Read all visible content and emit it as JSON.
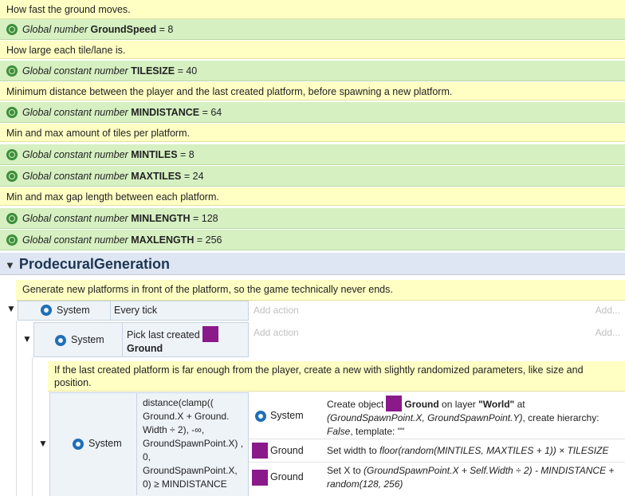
{
  "comments": {
    "c1": "How fast the ground moves.",
    "c2": "How large each tile/lane is.",
    "c3": "Minimum distance between the player and the last created platform, before spawning a new platform.",
    "c4": "Min and max amount of tiles per platform.",
    "c5": "Min and max gap length between each platform.",
    "c6": "Generate new platforms in front of the platform, so the game technically never ends.",
    "c7": "If the last created platform is far enough from the player, create a new with slightly randomized parameters, like size and position."
  },
  "vars": {
    "v1": {
      "prefix": "Global number",
      "name": "GroundSpeed",
      "value": "= 8"
    },
    "v2": {
      "prefix": "Global constant number",
      "name": "TILESIZE",
      "value": "= 40"
    },
    "v3": {
      "prefix": "Global constant number",
      "name": "MINDISTANCE",
      "value": "= 64"
    },
    "v4": {
      "prefix": "Global constant number",
      "name": "MINTILES",
      "value": "= 8"
    },
    "v5": {
      "prefix": "Global constant number",
      "name": "MAXTILES",
      "value": "= 24"
    },
    "v6": {
      "prefix": "Global constant number",
      "name": "MINLENGTH",
      "value": "= 128"
    },
    "v7": {
      "prefix": "Global constant number",
      "name": "MAXLENGTH",
      "value": "= 256"
    }
  },
  "group": {
    "title": "ProdecuralGeneration"
  },
  "events": {
    "e1": {
      "object": "System",
      "condition": "Every tick",
      "add_action": "Add action",
      "add_more": "Add..."
    },
    "e2": {
      "object": "System",
      "condition": "Pick last created",
      "ground": "Ground",
      "add_action": "Add action",
      "add_more": "Add..."
    },
    "e3": {
      "object": "System",
      "condition": "distance(clamp(( Ground.X + Ground. Width ÷ 2), -∞, GroundSpawnPoint.X) , 0, GroundSpawnPoint.X, 0) ≥ MINDISTANCE",
      "a1_object": "System",
      "a1_text_pre": "Create object",
      "a1_ground": "Ground",
      "a1_text_mid": "on layer",
      "a1_layer": "\"World\"",
      "a1_text_post": "at",
      "a1_coords": "(GroundSpawnPoint.X, GroundSpawnPoint.Y)",
      "a1_hier": ", create hierarchy:",
      "a1_false": "False",
      "a1_template": ", template: \"\"",
      "a2_object": "Ground",
      "a2_pre": "Set width to",
      "a2_expr": "floor(random(MINTILES, MAXTILES + 1)) × TILESIZE",
      "a3_object": "Ground",
      "a3_pre": "Set X to",
      "a3_expr": "(GroundSpawnPoint.X + Self.Width ÷ 2) - MINDISTANCE + random(128, 256)"
    }
  }
}
